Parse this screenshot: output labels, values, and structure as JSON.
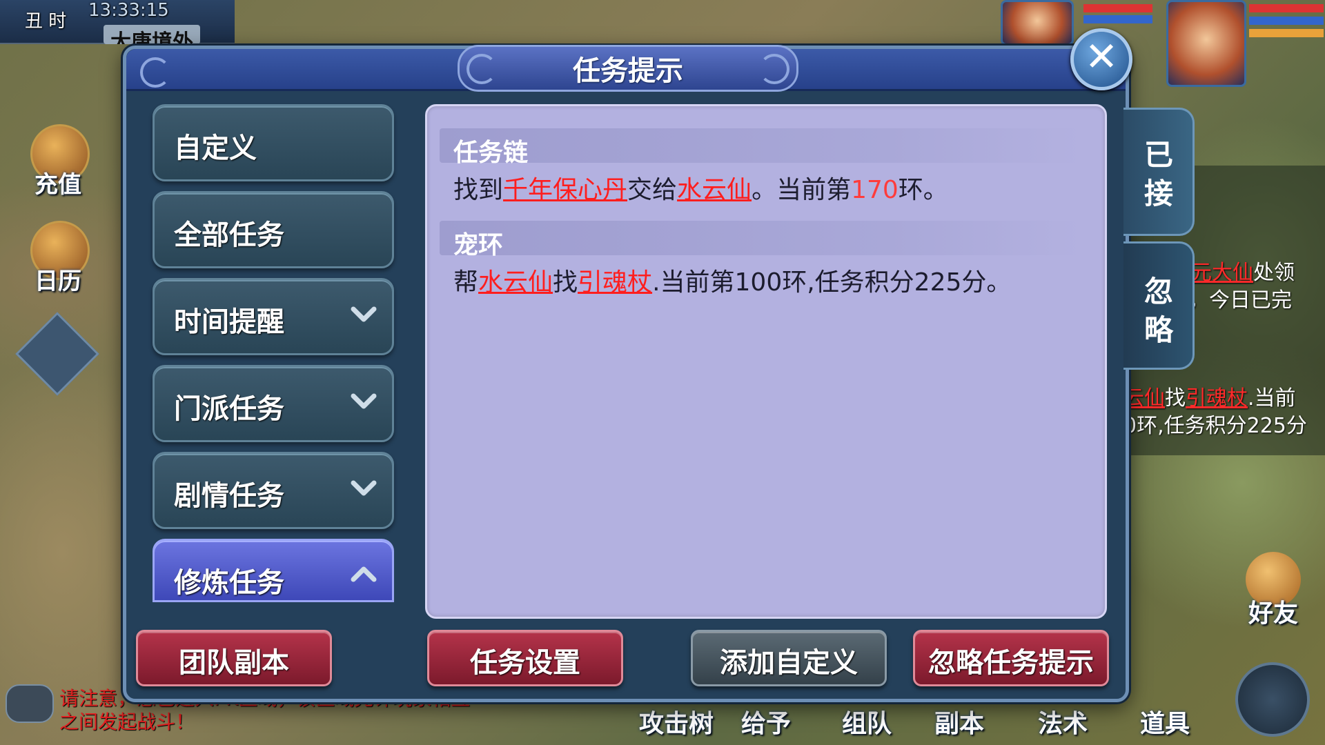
{
  "hud": {
    "shichen": "丑 时",
    "clock": "13:33:15",
    "location": "大唐境外",
    "recharge_label": "充值",
    "calendar_label": "日历",
    "friend_label": "好友"
  },
  "background_quest_panel": {
    "line1_red": "元大仙",
    "line1_rest": "处领",
    "line2": "，今日已完",
    "line3_red1": "云仙",
    "line3_mid": "找",
    "line3_red2": "引魂杖",
    "line3_rest": ".当前",
    "line4": "0环,任务积分225分"
  },
  "bottom_bar": {
    "items": [
      "攻击树",
      "给予",
      "组队",
      "副本",
      "法术",
      "道具"
    ]
  },
  "notice": {
    "text": "请注意，您已进入PK区域，该区域允许玩家相互之间发起战斗！"
  },
  "dialog": {
    "title": "任务提示",
    "close_symbol": "✕",
    "categories": [
      {
        "label": "自定义",
        "chevron": ""
      },
      {
        "label": "全部任务",
        "chevron": ""
      },
      {
        "label": "时间提醒",
        "chevron": "down"
      },
      {
        "label": "门派任务",
        "chevron": "down"
      },
      {
        "label": "剧情任务",
        "chevron": "down"
      },
      {
        "label": "修炼任务",
        "chevron": "up"
      }
    ],
    "active_category": "修炼任务",
    "sections": [
      {
        "title": "任务链",
        "p1": "找到",
        "r1": "千年保心丹",
        "p2": "交给",
        "r2": "水云仙",
        "p3": "。当前第",
        "num": "170",
        "p4": "环。"
      },
      {
        "title": "宠环",
        "p1": "帮",
        "r1": "水云仙",
        "p2": "找",
        "r2": "引魂杖",
        "p3": ".当前第100环,任务积分225分。"
      }
    ],
    "right_tabs": {
      "accepted": "已接",
      "ignored": "忽略"
    },
    "buttons": {
      "team_dungeon": "团队副本",
      "task_settings": "任务设置",
      "add_custom": "添加自定义",
      "ignore_tips": "忽略任务提示"
    }
  },
  "colors": {
    "dialog_bg": "#24405a",
    "content_bg": "#b3b1e0",
    "active_tab": "#5a64d0",
    "link_red": "#ff1e1e",
    "button_red": "#9a2438"
  }
}
